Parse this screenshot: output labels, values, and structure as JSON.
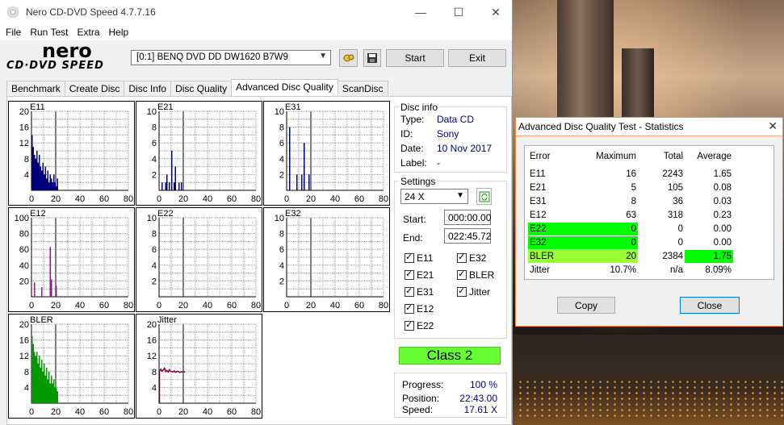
{
  "app": {
    "title": "Nero CD-DVD Speed 4.7.7.16",
    "logo_top": "nero",
    "logo_bottom": "CD·DVD SPEED",
    "minimize": "—",
    "maximize": "☐",
    "close": "✕"
  },
  "menu": [
    "File",
    "Run Test",
    "Extra",
    "Help"
  ],
  "toolbar": {
    "drive": "[0:1]   BENQ DVD DD DW1620 B7W9",
    "start_label": "Start",
    "exit_label": "Exit"
  },
  "tabs": [
    "Benchmark",
    "Create Disc",
    "Disc Info",
    "Disc Quality",
    "Advanced Disc Quality",
    "ScanDisc"
  ],
  "active_tab": "Advanced Disc Quality",
  "disc_info": {
    "legend": "Disc info",
    "type_label": "Type:",
    "type_value": "Data CD",
    "id_label": "ID:",
    "id_value": "Sony",
    "date_label": "Date:",
    "date_value": "10 Nov 2017",
    "label_label": "Label:",
    "label_value": "-"
  },
  "settings": {
    "legend": "Settings",
    "speed": "24 X",
    "start_label": "Start:",
    "start_value": "000:00.00",
    "end_label": "End:",
    "end_value": "022:45.72",
    "checks": [
      "E11",
      "E32",
      "E21",
      "BLER",
      "E31",
      "Jitter",
      "E12",
      "E22"
    ]
  },
  "class_label": "Class 2",
  "progress": {
    "progress_label": "Progress:",
    "progress_value": "100 %",
    "position_label": "Position:",
    "position_value": "22:43.00",
    "speed_label": "Speed:",
    "speed_value": "17.61 X"
  },
  "colors": {
    "navy": "#00007f",
    "purple": "#8b1a8b",
    "green": "#009900",
    "maroon": "#800040"
  },
  "chart_data": [
    {
      "type": "bar",
      "title": "E11",
      "ylim": [
        0,
        20
      ],
      "yticks": [
        4,
        8,
        12,
        16,
        20
      ],
      "xticks": [
        0,
        20,
        40,
        60,
        80
      ],
      "color": "#00007f",
      "values": [
        14,
        11,
        9,
        8,
        10,
        7,
        9,
        6,
        5,
        7,
        4,
        6,
        3,
        5,
        2,
        4,
        3,
        2,
        4,
        2,
        1,
        3
      ]
    },
    {
      "type": "bar",
      "title": "E21",
      "ylim": [
        0,
        10
      ],
      "yticks": [
        2,
        4,
        6,
        8,
        10
      ],
      "xticks": [
        0,
        20,
        40,
        60,
        80
      ],
      "color": "#00007f",
      "values": [
        0,
        0,
        1,
        0,
        0,
        1,
        2,
        0,
        1,
        0,
        5,
        0,
        1,
        3,
        0,
        0,
        1,
        0,
        1,
        0,
        0,
        0
      ]
    },
    {
      "type": "bar",
      "title": "E31",
      "ylim": [
        0,
        10
      ],
      "yticks": [
        2,
        4,
        6,
        8,
        10
      ],
      "xticks": [
        0,
        20,
        40,
        60,
        80
      ],
      "color": "#00007f",
      "values": [
        0,
        0,
        8,
        0,
        0,
        0,
        0,
        0,
        2,
        0,
        0,
        0,
        2,
        0,
        6,
        0,
        0,
        0,
        2,
        0,
        0,
        0
      ]
    },
    {
      "type": "bar",
      "title": "E12",
      "ylim": [
        0,
        100
      ],
      "yticks": [
        20,
        40,
        60,
        80,
        100
      ],
      "xticks": [
        0,
        20,
        40,
        60,
        80
      ],
      "color": "#8b1a8b",
      "values": [
        0,
        0,
        18,
        0,
        0,
        0,
        0,
        0,
        12,
        0,
        0,
        0,
        0,
        0,
        0,
        63,
        22,
        0,
        0,
        0,
        14,
        0
      ]
    },
    {
      "type": "bar",
      "title": "E22",
      "ylim": [
        0,
        10
      ],
      "yticks": [
        2,
        4,
        6,
        8,
        10
      ],
      "xticks": [
        0,
        20,
        40,
        60,
        80
      ],
      "color": "#8b1a8b",
      "values": []
    },
    {
      "type": "bar",
      "title": "E32",
      "ylim": [
        0,
        10
      ],
      "yticks": [
        2,
        4,
        6,
        8,
        10
      ],
      "xticks": [
        0,
        20,
        40,
        60,
        80
      ],
      "color": "#8b1a8b",
      "values": []
    },
    {
      "type": "bar",
      "title": "BLER",
      "ylim": [
        0,
        20
      ],
      "yticks": [
        4,
        8,
        12,
        16,
        20
      ],
      "xticks": [
        0,
        20,
        40,
        60,
        80
      ],
      "color": "#009900",
      "values": [
        17,
        15,
        13,
        12,
        13,
        10,
        12,
        9,
        11,
        8,
        10,
        7,
        9,
        6,
        8,
        5,
        7,
        5,
        6,
        4,
        4,
        3
      ]
    },
    {
      "type": "line",
      "title": "Jitter",
      "ylim": [
        0,
        20
      ],
      "yticks": [
        4,
        8,
        12,
        16,
        20
      ],
      "xticks": [
        0,
        20,
        40,
        60,
        80
      ],
      "color": "#800040",
      "values": [
        8.2,
        8.6,
        8.1,
        8.4,
        8.9,
        8.0,
        8.3,
        7.9,
        8.5,
        8.1,
        8.0,
        7.9,
        8.2,
        7.8,
        8.0,
        8.1,
        7.9,
        7.8,
        8.0,
        7.9,
        8.0,
        7.9
      ]
    }
  ],
  "stats": {
    "title": "Advanced Disc Quality Test - Statistics",
    "close": "✕",
    "headers": [
      "Error",
      "Maximum",
      "Total",
      "Average"
    ],
    "rows": [
      {
        "name": "E11",
        "max": "16",
        "total": "2243",
        "avg": "1.65",
        "hl": ""
      },
      {
        "name": "E21",
        "max": "5",
        "total": "105",
        "avg": "0.08",
        "hl": ""
      },
      {
        "name": "E31",
        "max": "8",
        "total": "36",
        "avg": "0.03",
        "hl": ""
      },
      {
        "name": "E12",
        "max": "63",
        "total": "318",
        "avg": "0.23",
        "hl": ""
      },
      {
        "name": "E22",
        "max": "0",
        "total": "0",
        "avg": "0.00",
        "hl": "green"
      },
      {
        "name": "E32",
        "max": "0",
        "total": "0",
        "avg": "0.00",
        "hl": "green"
      },
      {
        "name": "BLER",
        "max": "20",
        "total": "2384",
        "avg": "1.75",
        "hl": "yellow"
      },
      {
        "name": "Jitter",
        "max": "10.7%",
        "total": "n/a",
        "avg": "8.09%",
        "hl": ""
      }
    ],
    "copy_label": "Copy",
    "close_label": "Close"
  }
}
